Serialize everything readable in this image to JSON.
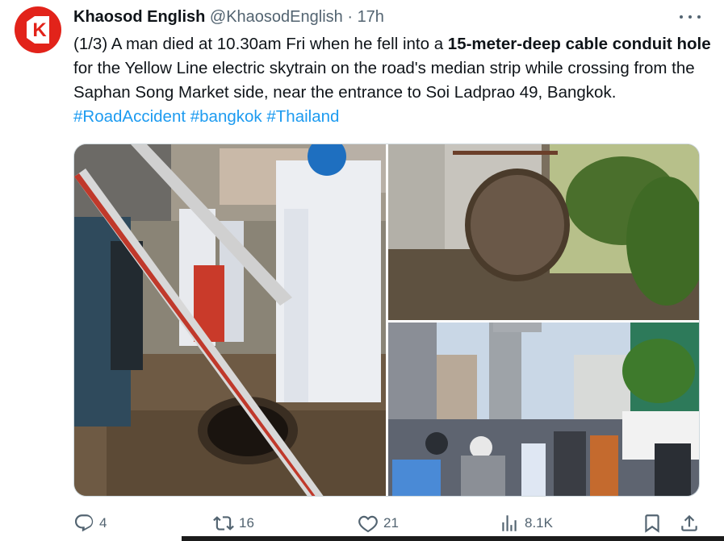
{
  "author": {
    "name": "Khaosod English",
    "handle": "@KhaosodEnglish",
    "separator": "·",
    "time": "17h",
    "avatar_letter": "K",
    "avatar_color": "#e2231a"
  },
  "tweet": {
    "text_part1": "(1/3) A man died at 10.30am Fri when he fell into a ",
    "text_bold": "15-meter-deep cable conduit hole",
    "text_part2": " for the Yellow Line electric skytrain on the road's median strip while crossing from the Saphan Song Market side, near the entrance to Soi Ladprao 49, Bangkok. ",
    "hashtags": [
      "#RoadAccident",
      "#bangkok",
      "#Thailand"
    ]
  },
  "media": {
    "count": 3,
    "photos": [
      {
        "description_icon": "photo-rescue-workers-ladder"
      },
      {
        "description_icon": "photo-manhole-cover"
      },
      {
        "description_icon": "photo-street-crowd"
      }
    ]
  },
  "actions": {
    "reply": {
      "icon": "reply-icon",
      "count": "4"
    },
    "retweet": {
      "icon": "retweet-icon",
      "count": "16"
    },
    "like": {
      "icon": "heart-icon",
      "count": "21"
    },
    "views": {
      "icon": "views-icon",
      "count": "8.1K"
    },
    "bookmark": {
      "icon": "bookmark-icon"
    },
    "share": {
      "icon": "share-icon"
    }
  },
  "colors": {
    "accent": "#1d9bf0",
    "secondary_text": "#536471",
    "primary_text": "#0f1419"
  }
}
